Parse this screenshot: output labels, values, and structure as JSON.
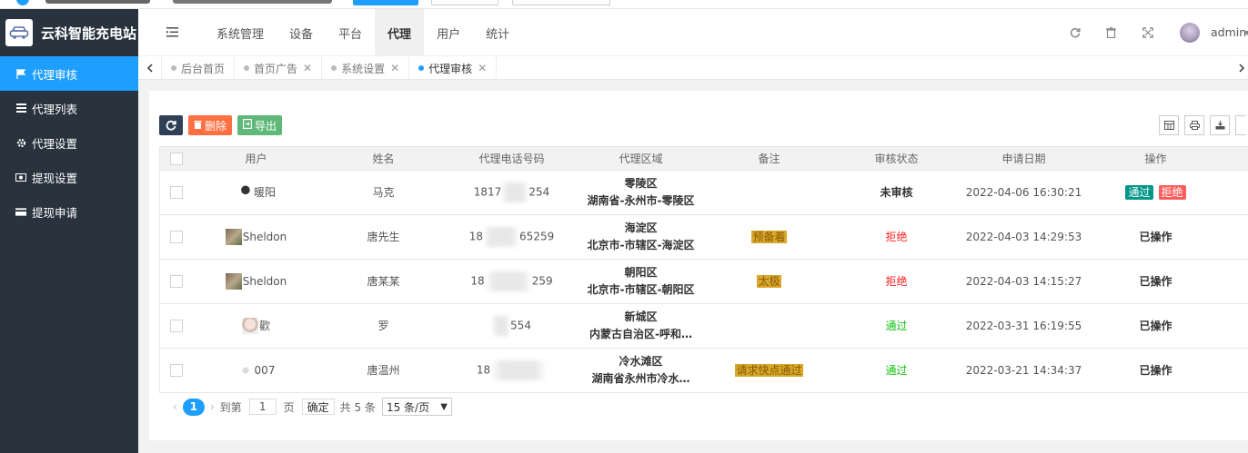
{
  "app": {
    "title": "云科智能充电站"
  },
  "sidebar": {
    "items": [
      {
        "label": "代理审核",
        "icon": "flag-icon",
        "active": true
      },
      {
        "label": "代理列表",
        "icon": "list-icon",
        "active": false
      },
      {
        "label": "代理设置",
        "icon": "gear-icon",
        "active": false
      },
      {
        "label": "提现设置",
        "icon": "money-icon",
        "active": false
      },
      {
        "label": "提现申请",
        "icon": "card-icon",
        "active": false
      }
    ]
  },
  "header": {
    "nav": [
      "系统管理",
      "设备",
      "平台",
      "代理",
      "用户",
      "统计"
    ],
    "active_nav": "代理",
    "user": "admin"
  },
  "tabs": [
    {
      "label": "后台首页",
      "closable": false
    },
    {
      "label": "首页广告",
      "closable": true
    },
    {
      "label": "系统设置",
      "closable": true
    },
    {
      "label": "代理审核",
      "closable": true,
      "active": true
    }
  ],
  "toolbar": {
    "delete_label": "删除",
    "export_label": "导出"
  },
  "table": {
    "columns": [
      "用户",
      "姓名",
      "代理电话号码",
      "代理区域",
      "备注",
      "审核状态",
      "申请日期",
      "操作"
    ],
    "rows": [
      {
        "user": "暖阳",
        "name": "马克",
        "phone_a": "1817",
        "phone_b": "254",
        "region1": "零陵区",
        "region2": "湖南省-永州市-零陵区",
        "note": "",
        "status": "未审核",
        "status_type": "wait",
        "date": "2022-04-06 16:30:21",
        "op_pass": "通过",
        "op_reject": "拒绝",
        "op": ""
      },
      {
        "user": "Sheldon",
        "name": "唐先生",
        "phone_a": "18",
        "phone_b": "65259",
        "region1": "海淀区",
        "region2": "北京市-市辖区-海淀区",
        "note": "预备着",
        "status": "拒绝",
        "status_type": "reject",
        "date": "2022-04-03 14:29:53",
        "op": "已操作"
      },
      {
        "user": "Sheldon",
        "name": "唐某某",
        "phone_a": "18",
        "phone_b": "259",
        "region1": "朝阳区",
        "region2": "北京市-市辖区-朝阳区",
        "note": "太极",
        "status": "拒绝",
        "status_type": "reject",
        "date": "2022-04-03 14:15:27",
        "op": "已操作"
      },
      {
        "user": "歡",
        "name": "罗",
        "phone_a": "",
        "phone_b": "554",
        "region1": "新城区",
        "region2": "内蒙古自治区-呼和…",
        "note": "",
        "status": "通过",
        "status_type": "pass",
        "date": "2022-03-31 16:19:55",
        "op": "已操作"
      },
      {
        "user": "007",
        "name": "唐温州",
        "phone_a": "18",
        "phone_b": "",
        "region1": "冷水滩区",
        "region2": "湖南省永州市冷水…",
        "note": "请求快点通过",
        "status": "通过",
        "status_type": "pass",
        "date": "2022-03-21 14:34:37",
        "op": "已操作"
      }
    ]
  },
  "pager": {
    "current": "1",
    "goto_label": "到第",
    "goto_value": "1",
    "page_label": "页",
    "confirm_label": "确定",
    "total_label": "共 5 条",
    "page_size": "15 条/页"
  },
  "colors": {
    "accent": "#1e9fff",
    "sidebar": "#28333e",
    "pass": "#009688",
    "reject": "#ff5e5e"
  }
}
